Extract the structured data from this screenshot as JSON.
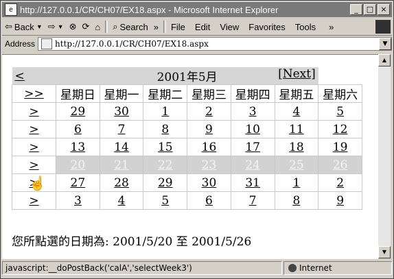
{
  "window": {
    "title": "http://127.0.0.1/CR/CH07/EX18.aspx - Microsoft Internet Explorer"
  },
  "toolbar": {
    "back": "Back",
    "search": "Search",
    "menus": [
      "File",
      "Edit",
      "View",
      "Favorites",
      "Tools"
    ]
  },
  "address": {
    "label": "Address",
    "url": "http://127.0.0.1/CR/CH07/EX18.aspx"
  },
  "calendar": {
    "prev": "<",
    "title": "2001年5月",
    "next": "[Next]",
    "select_month": ">>",
    "select_week": ">",
    "day_names": [
      "星期日",
      "星期一",
      "星期二",
      "星期三",
      "星期四",
      "星期五",
      "星期六"
    ],
    "weeks": [
      [
        "29",
        "30",
        "1",
        "2",
        "3",
        "4",
        "5"
      ],
      [
        "6",
        "7",
        "8",
        "9",
        "10",
        "11",
        "12"
      ],
      [
        "13",
        "14",
        "15",
        "16",
        "17",
        "18",
        "19"
      ],
      [
        "20",
        "21",
        "22",
        "23",
        "24",
        "25",
        "26"
      ],
      [
        "27",
        "28",
        "29",
        "30",
        "31",
        "1",
        "2"
      ],
      [
        "3",
        "4",
        "5",
        "6",
        "7",
        "8",
        "9"
      ]
    ],
    "selected_week_index": 3
  },
  "selection_text": "您所點選的日期為: 2001/5/20 至 2001/5/26",
  "status": {
    "text": "javascript:__doPostBack('calA','selectWeek3')",
    "zone": "Internet"
  }
}
